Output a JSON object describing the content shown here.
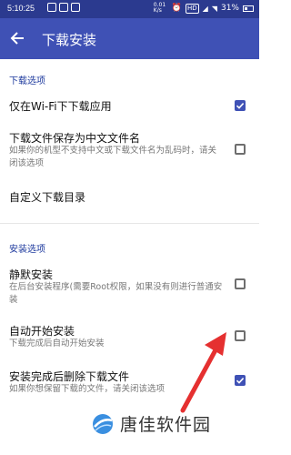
{
  "status_bar": {
    "time": "5:10:25",
    "network_speed": "0.01 K/s",
    "signal_label": "HD",
    "battery": "31%"
  },
  "appbar": {
    "back_icon": "arrow-left-icon",
    "title": "下载安装"
  },
  "sections": [
    {
      "header": "下载选项",
      "items": [
        {
          "title": "仅在Wi-Fi下下载应用",
          "subtitle": "",
          "checked": true
        },
        {
          "title": "下载文件保存为中文文件名",
          "subtitle": "如果你的机型不支持中文或下载文件名为乱码时，请关闭该选项",
          "checked": false
        },
        {
          "title": "自定义下载目录",
          "subtitle": "",
          "checked": null
        }
      ]
    },
    {
      "header": "安装选项",
      "items": [
        {
          "title": "静默安装",
          "subtitle": "在后台安装程序(需要Root权限，如果没有则进行普通安装",
          "checked": false
        },
        {
          "title": "自动开始安装",
          "subtitle": "下载完成后自动开始安装",
          "checked": false
        },
        {
          "title": "安装完成后删除下载文件",
          "subtitle": "如果你想保留下载的文件，请关闭该选项",
          "checked": true
        }
      ]
    }
  ],
  "watermark": {
    "text": "唐佳软件园",
    "logo_icon": "blue-globe-logo"
  },
  "annotation": {
    "arrow_color": "#e53030"
  },
  "colors": {
    "appbar": "#3f51b5",
    "statusbar": "#2b3a8f",
    "accent": "#3f51b5",
    "section_header": "#1e3a9e"
  }
}
